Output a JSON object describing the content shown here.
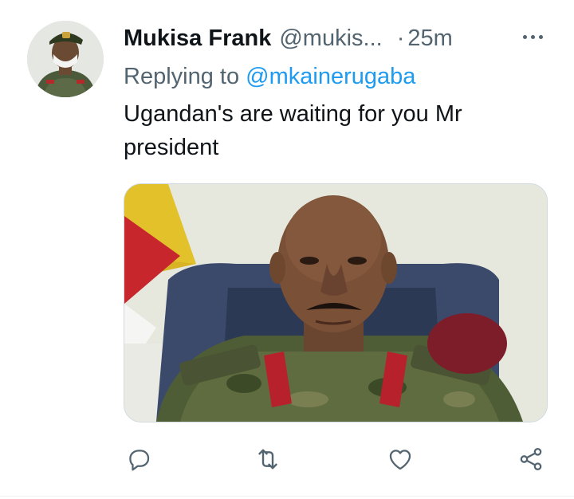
{
  "author": {
    "display_name": "Mukisa Frank",
    "handle": "@mukis...",
    "separator": "·",
    "time": "25m"
  },
  "reply": {
    "prefix": "Replying to",
    "mention": "@mkainerugaba"
  },
  "tweet": {
    "text": "Ugandan's are waiting for you Mr president"
  },
  "icons": {
    "more": "more-horizontal-icon",
    "reply": "reply-icon",
    "retweet": "retweet-icon",
    "like": "heart-icon",
    "share": "share-icon"
  },
  "colors": {
    "text_primary": "#0f1419",
    "text_secondary": "#536471",
    "link": "#1d9bf0",
    "border": "#cfd9de"
  }
}
